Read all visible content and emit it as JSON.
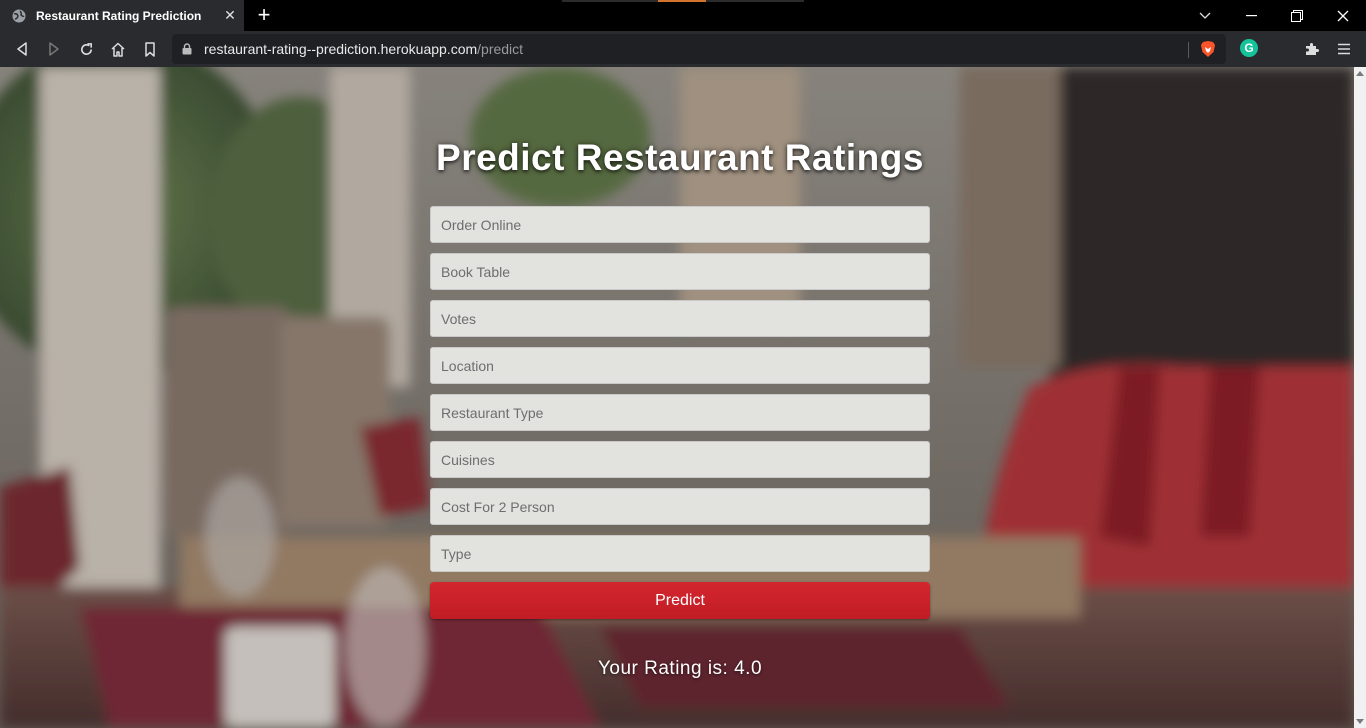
{
  "browser": {
    "tab_title": "Restaurant Rating Prediction",
    "url_host": "restaurant-rating--prediction.herokuapp.com",
    "url_path": "/predict",
    "extension_letter": "G"
  },
  "page": {
    "title": "Predict Restaurant Ratings",
    "fields": [
      {
        "placeholder": "Order Online",
        "value": ""
      },
      {
        "placeholder": "Book Table",
        "value": ""
      },
      {
        "placeholder": "Votes",
        "value": ""
      },
      {
        "placeholder": "Location",
        "value": ""
      },
      {
        "placeholder": "Restaurant Type",
        "value": ""
      },
      {
        "placeholder": "Cuisines",
        "value": ""
      },
      {
        "placeholder": "Cost For 2 Person",
        "value": ""
      },
      {
        "placeholder": "Type",
        "value": ""
      }
    ],
    "predict_label": "Predict",
    "result_text": "Your Rating is: 4.0"
  },
  "colors": {
    "accent_button": "#c8202a",
    "input_bg": "#e2e2df",
    "chrome_bg": "#2a2b2f"
  }
}
